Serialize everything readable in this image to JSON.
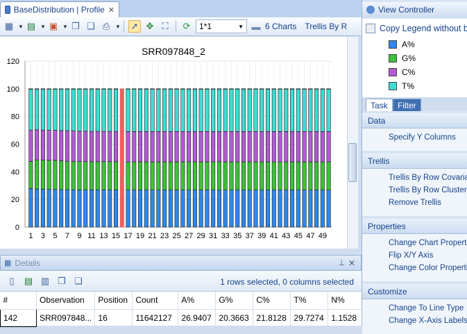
{
  "doc_tab": {
    "title": "BaseDistribution | Profile"
  },
  "toolbar": {
    "zoom_value": "1*1",
    "charts_label": "6 Charts",
    "trellis_label": "Trellis By R"
  },
  "chart_data": {
    "type": "bar",
    "stacked": true,
    "title": "SRR097848_2",
    "xlabel": "",
    "ylabel": "",
    "ylim": [
      0,
      120
    ],
    "yticks": [
      0,
      20,
      40,
      60,
      80,
      100,
      120
    ],
    "categories": [
      1,
      2,
      3,
      4,
      5,
      6,
      7,
      8,
      9,
      10,
      11,
      12,
      13,
      14,
      15,
      16,
      17,
      18,
      19,
      20,
      21,
      22,
      23,
      24,
      25,
      26,
      27,
      28,
      29,
      30,
      31,
      32,
      33,
      34,
      35,
      36,
      37,
      38,
      39,
      40,
      41,
      42,
      43,
      44,
      45,
      46,
      47,
      48,
      49,
      50
    ],
    "xtick_labels": [
      "1",
      "3",
      "5",
      "7",
      "9",
      "11",
      "13",
      "15",
      "17",
      "19",
      "21",
      "23",
      "25",
      "27",
      "29",
      "31",
      "33",
      "35",
      "37",
      "39",
      "41",
      "43",
      "45",
      "47",
      "49"
    ],
    "highlighted_category": 16,
    "highlight_color": "#f25c5c",
    "series": [
      {
        "name": "A%",
        "color": "#2f88ec",
        "values": [
          27.9,
          27.6,
          27.4,
          27.2,
          27.3,
          27.1,
          27.0,
          27.0,
          26.9,
          26.9,
          26.9,
          26.9,
          26.9,
          26.9,
          26.9,
          26.9407,
          26.8,
          26.8,
          26.8,
          26.8,
          26.8,
          26.8,
          26.8,
          26.8,
          26.8,
          26.8,
          26.8,
          26.8,
          26.8,
          26.8,
          26.8,
          26.8,
          26.8,
          26.8,
          26.8,
          26.8,
          26.8,
          26.8,
          26.8,
          26.8,
          26.8,
          26.8,
          26.8,
          26.8,
          26.8,
          26.8,
          26.8,
          26.8,
          26.8,
          26.8
        ]
      },
      {
        "name": "G%",
        "color": "#3cc239",
        "values": [
          19.6,
          21.0,
          21.1,
          21.1,
          20.9,
          20.8,
          20.6,
          20.5,
          20.5,
          20.5,
          20.4,
          20.4,
          20.4,
          20.4,
          20.4,
          20.3663,
          20.4,
          20.4,
          20.4,
          20.4,
          20.4,
          20.4,
          20.4,
          20.4,
          20.4,
          20.4,
          20.4,
          20.4,
          20.4,
          20.4,
          20.4,
          20.4,
          20.4,
          20.4,
          20.4,
          20.4,
          20.4,
          20.4,
          20.4,
          20.4,
          20.4,
          20.4,
          20.4,
          20.4,
          20.4,
          20.4,
          20.4,
          20.4,
          20.4,
          20.4
        ]
      },
      {
        "name": "C%",
        "color": "#b35ad6",
        "values": [
          22.5,
          21.8,
          21.7,
          21.7,
          21.8,
          21.9,
          22.0,
          22.0,
          21.9,
          21.9,
          21.9,
          21.9,
          21.9,
          21.9,
          21.9,
          21.8128,
          21.9,
          21.9,
          21.9,
          21.9,
          21.9,
          21.9,
          21.9,
          21.9,
          21.9,
          21.9,
          21.9,
          21.9,
          21.9,
          21.9,
          21.9,
          21.9,
          21.9,
          21.9,
          21.9,
          21.9,
          21.9,
          21.9,
          21.9,
          21.9,
          21.9,
          21.9,
          21.9,
          21.9,
          21.9,
          21.9,
          21.9,
          21.9,
          21.9,
          21.9
        ]
      },
      {
        "name": "T%",
        "color": "#3fdcd2",
        "values": [
          29.8,
          29.4,
          29.6,
          29.8,
          29.8,
          30.0,
          30.2,
          30.3,
          30.5,
          30.5,
          30.6,
          30.6,
          30.6,
          30.6,
          30.6,
          29.7274,
          30.7,
          30.7,
          30.7,
          30.7,
          30.7,
          30.7,
          30.7,
          30.7,
          30.7,
          30.7,
          30.7,
          30.7,
          30.7,
          30.7,
          30.7,
          30.7,
          30.7,
          30.7,
          30.7,
          30.7,
          30.7,
          30.7,
          30.7,
          30.7,
          30.7,
          30.7,
          30.7,
          30.7,
          30.7,
          30.7,
          30.7,
          30.7,
          30.7,
          30.7
        ]
      },
      {
        "name": "N%",
        "color": "#000000",
        "values": [
          0.2,
          0.2,
          0.2,
          0.2,
          0.2,
          0.2,
          0.2,
          0.2,
          0.2,
          0.2,
          0.2,
          0.2,
          0.2,
          0.2,
          0.2,
          1.1528,
          0.2,
          0.2,
          0.2,
          0.2,
          0.2,
          0.2,
          0.2,
          0.2,
          0.2,
          0.2,
          0.2,
          0.2,
          0.2,
          0.2,
          0.2,
          0.2,
          0.2,
          0.2,
          0.2,
          0.2,
          0.2,
          0.2,
          0.2,
          0.2,
          0.2,
          0.2,
          0.2,
          0.2,
          0.2,
          0.2,
          0.2,
          0.2,
          0.2,
          0.2
        ]
      }
    ]
  },
  "details": {
    "title": "Details",
    "selection_info": "1 rows selected, 0 columns selected",
    "columns": [
      "#",
      "Observation",
      "Position",
      "Count",
      "A%",
      "G%",
      "C%",
      "T%",
      "N%"
    ],
    "row": [
      "142",
      "SRR097848...",
      "16",
      "11642127",
      "26.9407",
      "20.3663",
      "21.8128",
      "29.7274",
      "1.1528"
    ]
  },
  "right_panel": {
    "title": "View Controller",
    "copy_legend": "Copy Legend  without b",
    "legend": [
      {
        "label": "A%",
        "color": "#2f88ec"
      },
      {
        "label": "G%",
        "color": "#3cc239"
      },
      {
        "label": "C%",
        "color": "#b35ad6"
      },
      {
        "label": "T%",
        "color": "#3fdcd2"
      }
    ],
    "tabs": [
      "Task",
      "Filter"
    ],
    "sections": [
      {
        "title": "Data",
        "links": [
          "Specify Y Columns"
        ]
      },
      {
        "title": "Trellis",
        "links": [
          "Trellis By Row Covariate",
          "Trellis By Row Cluster",
          "Remove Trellis"
        ]
      },
      {
        "title": "Properties",
        "links": [
          "Change Chart Properties",
          "Flip X/Y Axis",
          "Change Color Properties"
        ]
      },
      {
        "title": "Customize",
        "links": [
          "Change To Line Type",
          "Change X-Axis Labels"
        ]
      }
    ]
  }
}
